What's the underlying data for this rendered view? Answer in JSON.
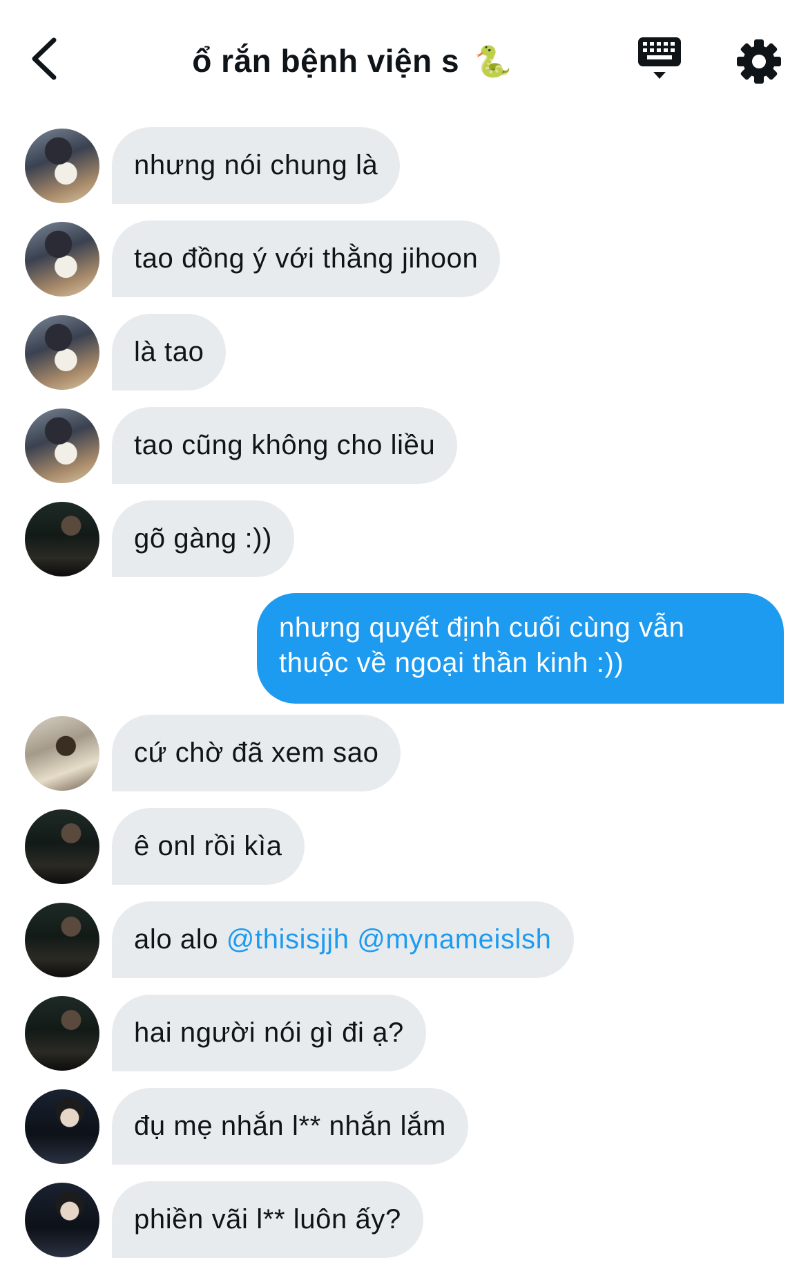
{
  "header": {
    "title": "ổ rắn bệnh viện s",
    "title_emoji": "🐍"
  },
  "messages": [
    {
      "text": "nhưng nói chung là"
    },
    {
      "text": "tao đồng ý với thằng jihoon"
    },
    {
      "text": "là tao"
    },
    {
      "text": "tao cũng không cho liều"
    },
    {
      "text": "gõ gàng :))"
    },
    {
      "text": "nhưng quyết định cuối cùng vẫn thuộc về ngoại thần kinh :))",
      "mine": true
    },
    {
      "text": "cứ chờ đã xem sao"
    },
    {
      "text": "ê onl rồi kìa"
    },
    {
      "text": "alo alo ",
      "mentions": [
        "@thisisjjh",
        "@mynameislsh"
      ]
    },
    {
      "text": "hai người nói gì đi ạ?"
    },
    {
      "text": "đụ mẹ nhắn l** nhắn lắm"
    },
    {
      "text": "phiền vãi l** luôn ấy?"
    }
  ],
  "colors": {
    "accent": "#1d9bf0",
    "bubble_received": "#e8ebee",
    "text": "#0f1419"
  },
  "icons": {
    "back": "chevron-left-icon",
    "keyboard": "keyboard-icon",
    "settings": "gear-icon"
  }
}
